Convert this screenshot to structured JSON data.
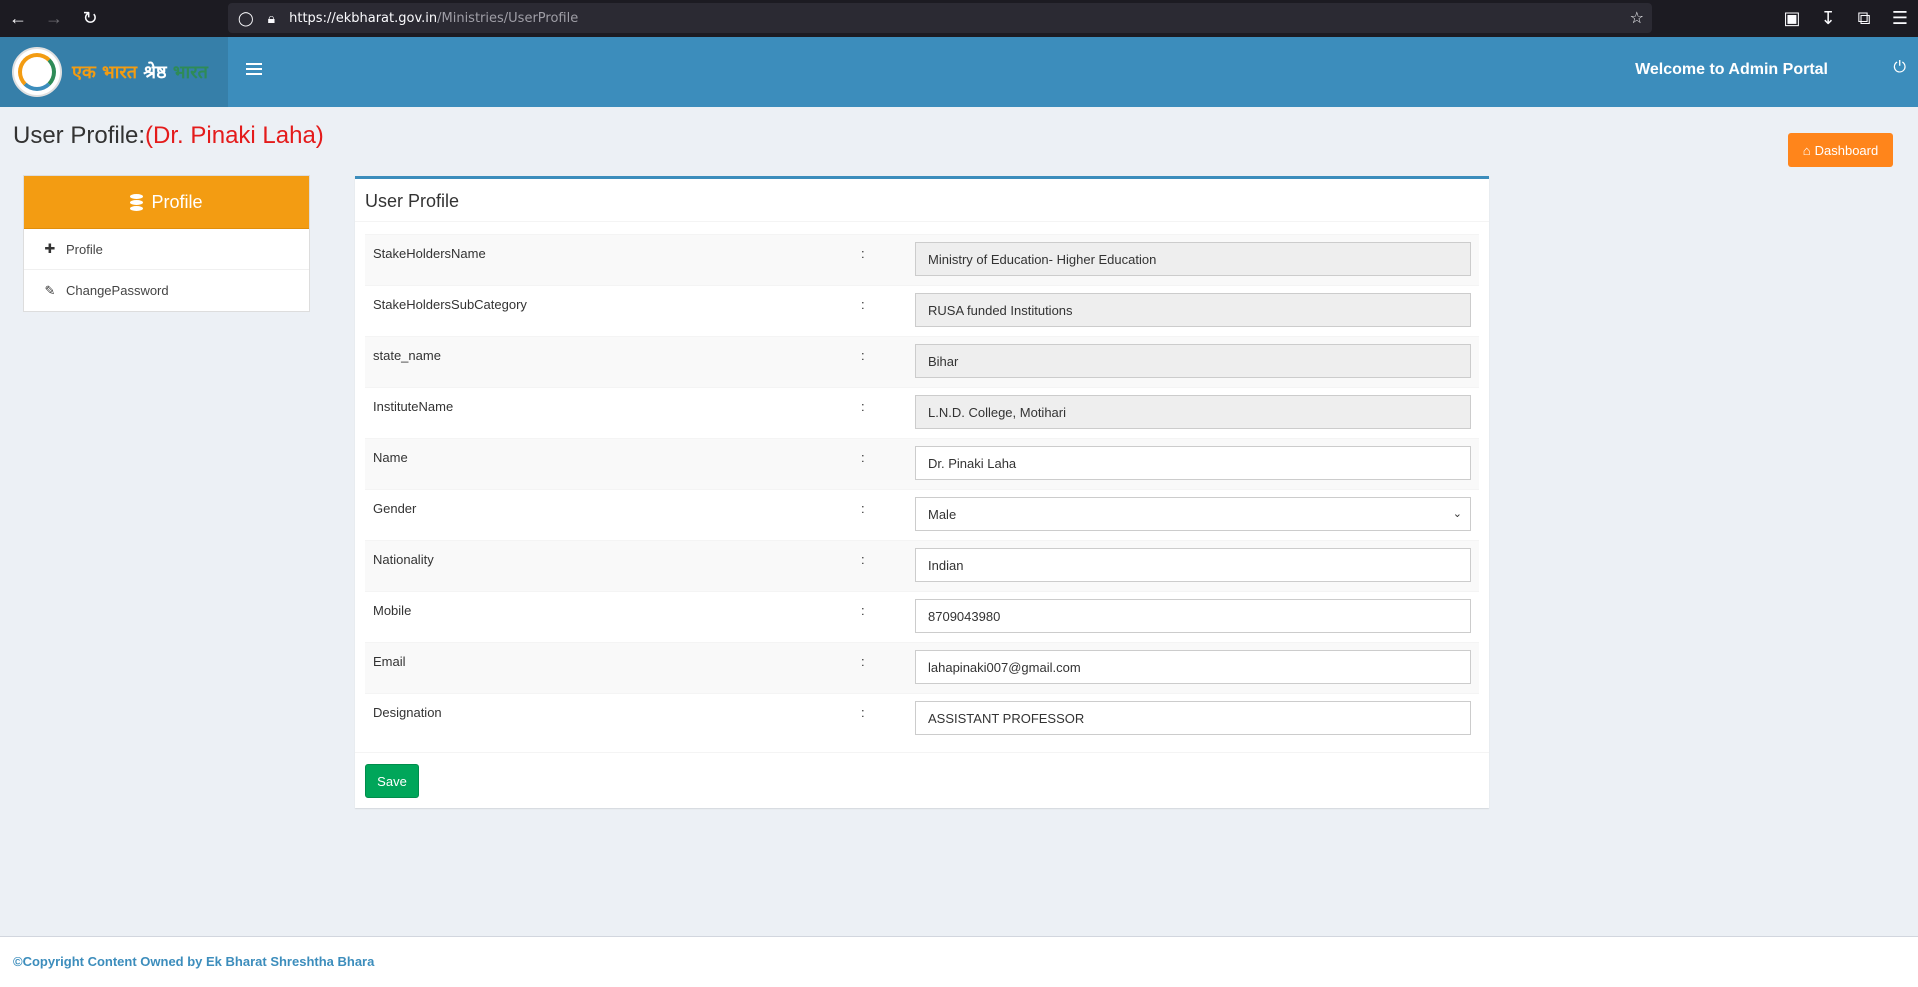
{
  "browser": {
    "url_host": "https://ekbharat.gov.in",
    "url_path": "/Ministries/UserProfile"
  },
  "header": {
    "logo_text_1": "एक भारत",
    "logo_text_2": "श्रेष्ठ",
    "logo_text_3": "भारत",
    "welcome": "Welcome to Admin Portal"
  },
  "page": {
    "title_prefix": "User Profile:",
    "title_name": "(Dr. Pinaki Laha)",
    "dashboard_label": "Dashboard"
  },
  "sidebar": {
    "heading": "Profile",
    "items": [
      {
        "label": "Profile",
        "icon": "user-plus-icon"
      },
      {
        "label": "ChangePassword",
        "icon": "pencil-icon"
      }
    ]
  },
  "profile": {
    "box_title": "User Profile",
    "fields": [
      {
        "label": "StakeHoldersName",
        "value": "Ministry of  Education- Higher Education",
        "readonly": true
      },
      {
        "label": "StakeHoldersSubCategory",
        "value": "RUSA funded Institutions",
        "readonly": true
      },
      {
        "label": "state_name",
        "value": "Bihar",
        "readonly": true
      },
      {
        "label": "InstituteName",
        "value": "L.N.D. College, Motihari",
        "readonly": true
      },
      {
        "label": "Name",
        "value": "Dr. Pinaki Laha",
        "readonly": false
      },
      {
        "label": "Gender",
        "value": "Male",
        "readonly": false,
        "type": "select"
      },
      {
        "label": "Nationality",
        "value": "Indian",
        "readonly": false
      },
      {
        "label": "Mobile",
        "value": "8709043980",
        "readonly": false
      },
      {
        "label": "Email",
        "value": "lahapinaki007@gmail.com",
        "readonly": false
      },
      {
        "label": "Designation",
        "value": "ASSISTANT PROFESSOR",
        "readonly": false
      }
    ],
    "colon": ":",
    "save_label": "Save"
  },
  "footer": {
    "text": "©Copyright Content Owned by Ek Bharat Shreshtha Bhara"
  },
  "colors": {
    "header": "#3c8dbc",
    "logo_bg": "#367fa9",
    "sidebar_head": "#f39c12",
    "dashboard_btn": "#ff851b",
    "save_btn": "#00a65a",
    "title_name": "#e41b1b"
  }
}
